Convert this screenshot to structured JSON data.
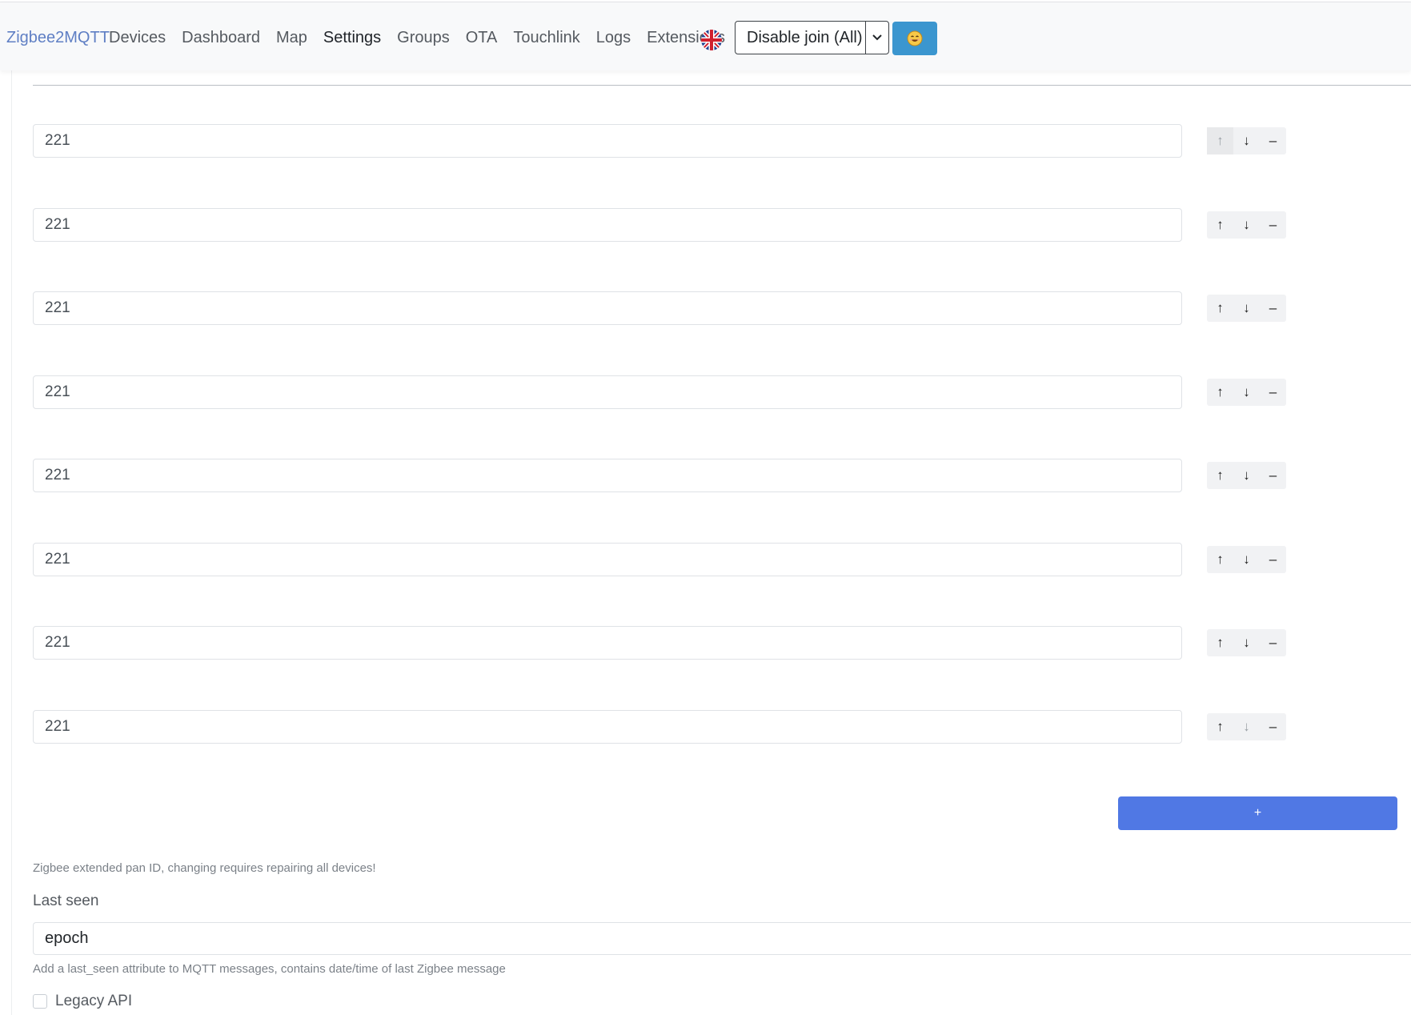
{
  "navbar": {
    "brand": "Zigbee2MQTT",
    "links": [
      "Devices",
      "Dashboard",
      "Map",
      "Settings",
      "Groups",
      "OTA",
      "Touchlink",
      "Logs",
      "Extensions"
    ],
    "active_link": "Settings",
    "language_icon": "uk-flag-icon",
    "join_button_label": "Disable join (All)",
    "join_caret_icon": "chevron-down-icon",
    "emoji_button_icon": "smiling-face-icon"
  },
  "list": {
    "items": [
      {
        "value": "221",
        "up_disabled": true,
        "down_disabled": false
      },
      {
        "value": "221",
        "up_disabled": false,
        "down_disabled": false
      },
      {
        "value": "221",
        "up_disabled": false,
        "down_disabled": false
      },
      {
        "value": "221",
        "up_disabled": false,
        "down_disabled": false
      },
      {
        "value": "221",
        "up_disabled": false,
        "down_disabled": false
      },
      {
        "value": "221",
        "up_disabled": false,
        "down_disabled": false
      },
      {
        "value": "221",
        "up_disabled": false,
        "down_disabled": false
      },
      {
        "value": "221",
        "up_disabled": false,
        "down_disabled": true
      }
    ],
    "up_glyph": "↑",
    "down_glyph": "↓",
    "remove_glyph": "–",
    "add_label": "+",
    "help": "Zigbee extended pan ID, changing requires repairing all devices!"
  },
  "last_seen": {
    "label": "Last seen",
    "value": "epoch",
    "help": "Add a last_seen attribute to MQTT messages, contains date/time of last Zigbee message"
  },
  "legacy_api": {
    "label": "Legacy API",
    "checked": false
  },
  "colors": {
    "brand": "#5f7fc4",
    "add_button": "#5078e4",
    "emoji_button": "#3b96cf"
  }
}
